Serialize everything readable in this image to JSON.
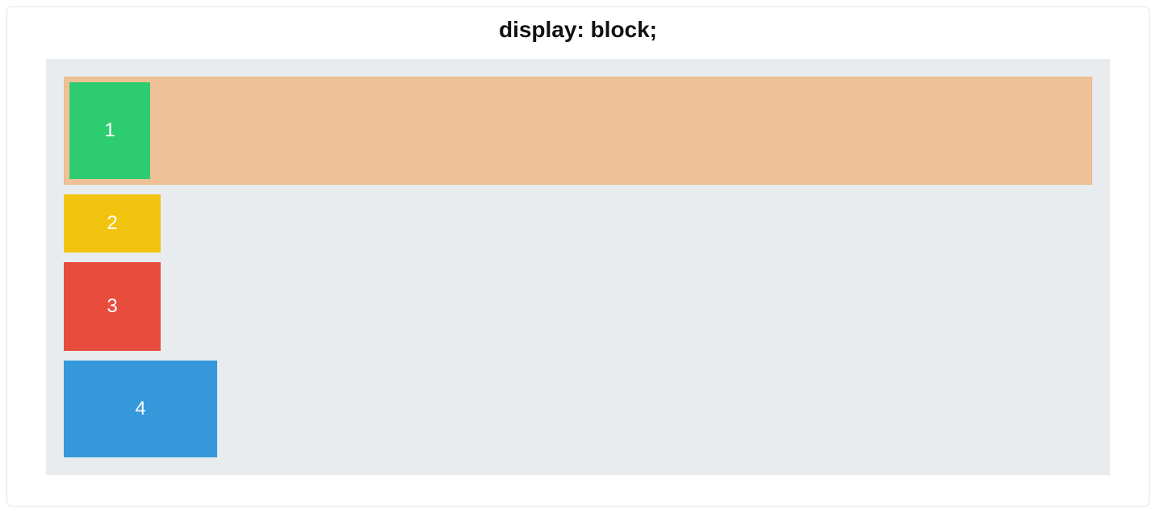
{
  "title": "display: block;",
  "boxes": [
    {
      "label": "1",
      "color": "#2ecc71",
      "highlighted": true
    },
    {
      "label": "2",
      "color": "#f1c40f",
      "highlighted": false
    },
    {
      "label": "3",
      "color": "#e74c3c",
      "highlighted": false
    },
    {
      "label": "4",
      "color": "#3498db",
      "highlighted": false
    }
  ],
  "colors": {
    "stage_background": "#e8ecef",
    "highlight_background": "#f0c196"
  }
}
